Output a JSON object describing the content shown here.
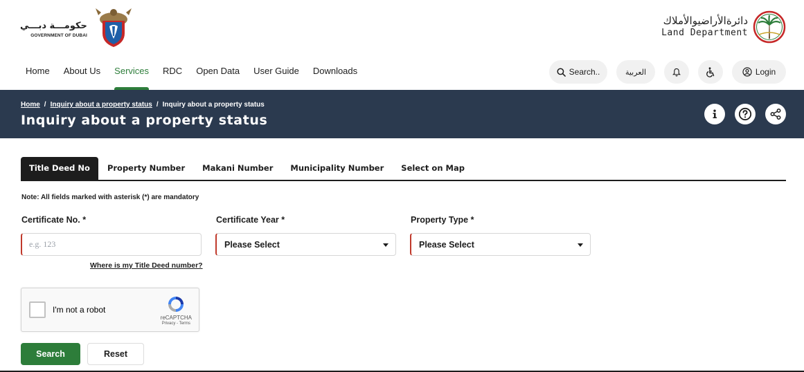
{
  "header": {
    "gov_logo": {
      "arabic": "حكومـــة دبـــي",
      "english": "GOVERNMENT OF DUBAI"
    },
    "dld_logo": {
      "arabic": "دائرةالأراضيوالأملاك",
      "english": "Land Department"
    }
  },
  "nav": {
    "links": [
      {
        "label": "Home",
        "active": false
      },
      {
        "label": "About Us",
        "active": false
      },
      {
        "label": "Services",
        "active": true
      },
      {
        "label": "RDC",
        "active": false
      },
      {
        "label": "Open Data",
        "active": false
      },
      {
        "label": "User Guide",
        "active": false
      },
      {
        "label": "Downloads",
        "active": false
      }
    ],
    "search_label": "Search..",
    "language_label": "العربية",
    "login_label": "Login",
    "notifications_icon": "bell-icon",
    "accessibility_icon": "wheelchair-icon",
    "accent_color": "#2d7d3a"
  },
  "banner": {
    "breadcrumb": {
      "home": "Home",
      "separator": "/",
      "parent": "Inquiry about a property status",
      "current": "Inquiry about a property status"
    },
    "title": "Inquiry about a property status",
    "background_color": "#2b3a4f",
    "icons": [
      "info-icon",
      "help-icon",
      "share-icon"
    ]
  },
  "tabs": [
    {
      "label": "Title Deed No",
      "active": true
    },
    {
      "label": "Property Number",
      "active": false
    },
    {
      "label": "Makani Number",
      "active": false
    },
    {
      "label": "Municipality Number",
      "active": false
    },
    {
      "label": "Select on Map",
      "active": false
    }
  ],
  "form": {
    "note": "Note: All fields marked with asterisk (*) are mandatory",
    "certificate_no": {
      "label": "Certificate No. *",
      "value": "",
      "placeholder": "e.g. 123"
    },
    "certificate_year": {
      "label": "Certificate Year *",
      "selected": "Please Select"
    },
    "property_type": {
      "label": "Property Type *",
      "selected": "Please Select"
    },
    "help_link": "Where is my Title Deed number?",
    "required_color": "#c0392b"
  },
  "captcha": {
    "label": "I'm not a robot",
    "brand": "reCAPTCHA",
    "terms": "Privacy - Terms",
    "checked": false
  },
  "buttons": {
    "search": "Search",
    "reset": "Reset",
    "primary_color": "#2d7d3a"
  }
}
